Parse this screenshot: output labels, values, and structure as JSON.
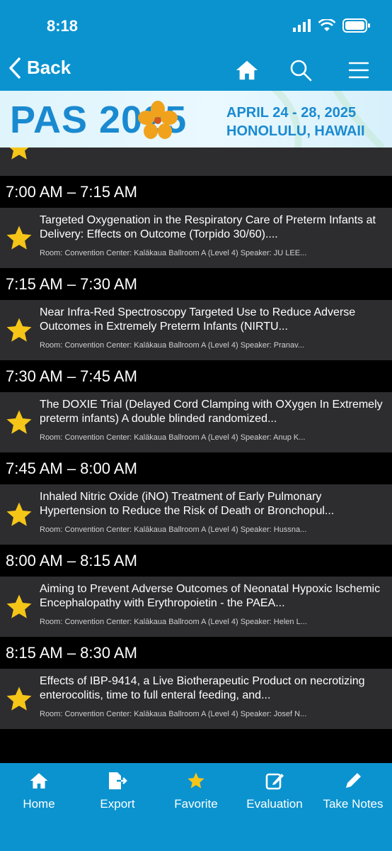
{
  "status": {
    "time": "8:18"
  },
  "nav": {
    "back_label": "Back"
  },
  "banner": {
    "brand": "PAS 2025",
    "dates": "APRIL 24 - 28, 2025",
    "location": "HONOLULU, HAWAII"
  },
  "sessions": [
    {
      "time": "7:00 AM – 7:15 AM",
      "title": "Targeted Oxygenation in the Respiratory Care of Preterm Infants at Delivery: Effects on Outcome (Torpido 30/60)....",
      "meta": "Room: Convention Center:  Kalākaua Ballroom A (Level 4) Speaker: JU LEE..."
    },
    {
      "time": "7:15 AM – 7:30 AM",
      "title": "Near Infra-Red Spectroscopy Targeted Use to Reduce Adverse Outcomes in Extremely Preterm Infants (NIRTU...",
      "meta": "Room: Convention Center:  Kalākaua Ballroom A (Level 4) Speaker: Pranav..."
    },
    {
      "time": "7:30 AM – 7:45 AM",
      "title": "The DOXIE Trial (Delayed Cord Clamping with OXygen In Extremely preterm infants) A double blinded randomized...",
      "meta": "Room: Convention Center:  Kalākaua Ballroom A (Level 4) Speaker: Anup K..."
    },
    {
      "time": "7:45 AM – 8:00 AM",
      "title": "Inhaled Nitric Oxide (iNO) Treatment of Early Pulmonary Hypertension to Reduce the Risk of Death or Bronchopul...",
      "meta": "Room: Convention Center:  Kalākaua Ballroom A (Level 4) Speaker: Hussna..."
    },
    {
      "time": "8:00 AM – 8:15 AM",
      "title": "Aiming to Prevent Adverse Outcomes of Neonatal Hypoxic Ischemic Encephalopathy with Erythropoietin - the PAEA...",
      "meta": "Room: Convention Center:  Kalākaua Ballroom A (Level 4) Speaker: Helen L..."
    },
    {
      "time": "8:15 AM – 8:30 AM",
      "title": "Effects of IBP-9414, a Live Biotherapeutic Product on necrotizing enterocolitis, time to full enteral feeding, and...",
      "meta": "Room: Convention Center:  Kalākaua Ballroom A (Level 4) Speaker: Josef N..."
    }
  ],
  "tabs": [
    "Home",
    "Export",
    "Favorite",
    "Evaluation",
    "Take Notes"
  ],
  "colors": {
    "accent": "#0b93cf",
    "star": "#f5c518",
    "row": "#2d2d30"
  }
}
